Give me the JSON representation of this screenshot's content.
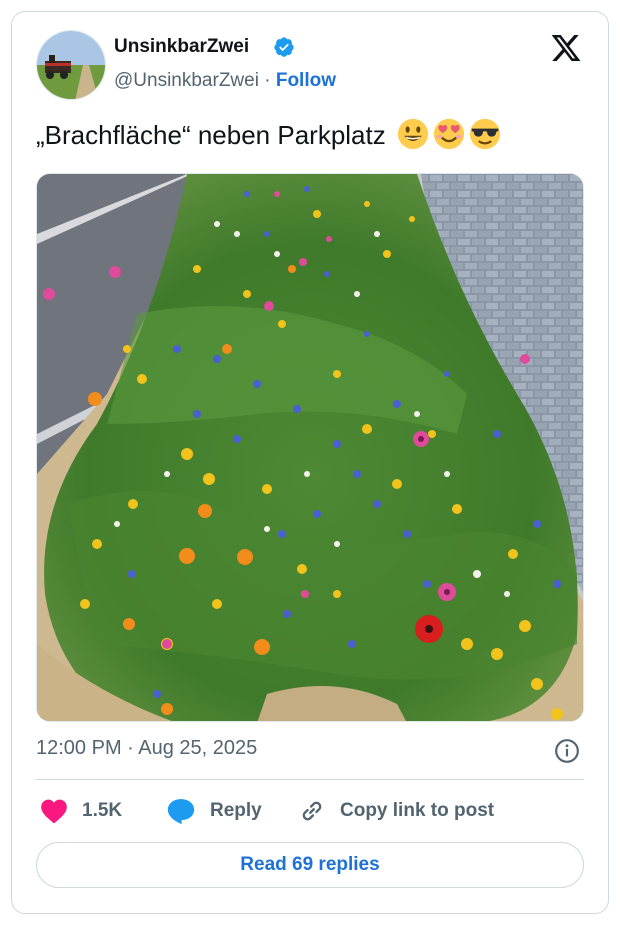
{
  "author": {
    "display_name": "UnsinkbarZwei",
    "handle": "@UnsinkbarZwei",
    "separator": "·",
    "follow_label": "Follow",
    "verified": true
  },
  "tweet": {
    "text": "„Brachfläche“ neben Parkplatz",
    "emojis": [
      "grinning-face",
      "smiling-face-with-heart-eyes",
      "smiling-face-with-sunglasses"
    ],
    "image_description_icon": "wildflower-meadow-photo"
  },
  "meta": {
    "timestamp": "12:00 PM · Aug 25, 2025"
  },
  "actions": {
    "like_count": "1.5K",
    "reply_label": "Reply",
    "copy_link_label": "Copy link to post"
  },
  "footer": {
    "read_replies_label": "Read 69 replies"
  },
  "colors": {
    "accent": "#1d72d8",
    "like": "#f91880",
    "verified": "#1d9bf0",
    "secondary_text": "#536471",
    "border": "#cfd9de"
  }
}
